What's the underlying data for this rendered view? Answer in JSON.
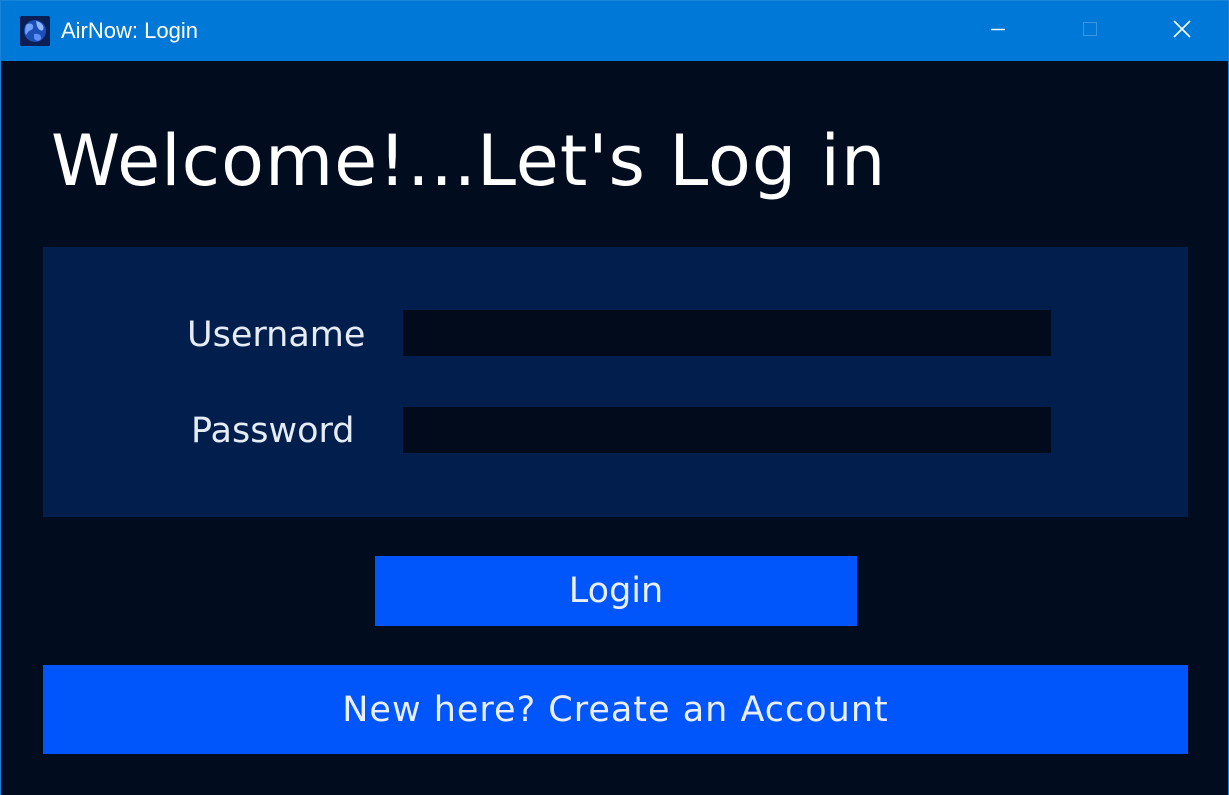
{
  "window": {
    "title": "AirNow: Login",
    "app_icon": "airnow-globe-icon",
    "controls": {
      "minimize_icon": "minimize-icon",
      "maximize_icon": "maximize-icon",
      "close_icon": "close-icon"
    }
  },
  "main": {
    "heading": "Welcome!...Let's Log in",
    "form": {
      "username_label": "Username",
      "username_value": "",
      "password_label": "Password",
      "password_value": ""
    },
    "login_button": "Login",
    "create_account_button": "New here? Create an Account"
  },
  "colors": {
    "titlebar": "#0078d7",
    "background": "#010c1f",
    "panel": "#011e4d",
    "input": "#020b1c",
    "button": "#0055fb"
  }
}
